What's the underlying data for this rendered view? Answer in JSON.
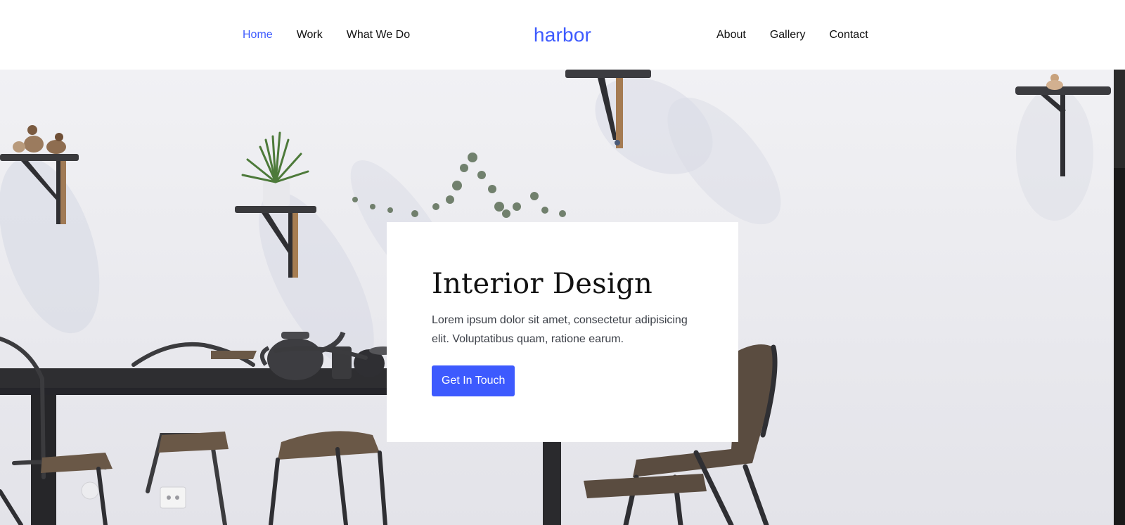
{
  "header": {
    "nav_left": [
      "Home",
      "Work",
      "What We Do"
    ],
    "nav_right": [
      "About",
      "Gallery",
      "Contact"
    ],
    "logo": "harbor",
    "active_item": "Home"
  },
  "hero": {
    "title": "Interior Design",
    "text": "Lorem ipsum dolor sit amet, consectetur adipisicing elit. Voluptatibus quam, ratione earum.",
    "button_label": "Get In Touch",
    "background_image": "dining room with dark chairs, table, teapot and wall shelves with plants"
  },
  "colors": {
    "accent": "#3d5afe",
    "text_dark": "#111111",
    "body_text": "#3c4048",
    "background": "#ffffff"
  }
}
